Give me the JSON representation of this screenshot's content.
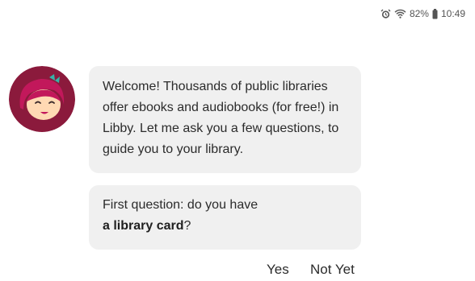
{
  "status_bar": {
    "icons": [
      "alarm-icon",
      "wifi-icon",
      "battery-icon"
    ],
    "battery": "82%",
    "time": "10:49"
  },
  "avatar": {
    "icon": "libby-avatar-icon",
    "colors": {
      "bg": "#8b1a3c",
      "hair": "#c2185b",
      "bow": "#36b3a8",
      "face": "#ffd9b3"
    }
  },
  "messages": [
    {
      "text": "Welcome! Thousands of public libraries offer ebooks and audiobooks (for free!) in Libby. Let me ask you a few questions, to guide you to your library."
    },
    {
      "prefix": "First question: do you have",
      "bold": "a library card",
      "suffix": "?"
    }
  ],
  "replies": {
    "yes": "Yes",
    "not_yet": "Not Yet"
  }
}
